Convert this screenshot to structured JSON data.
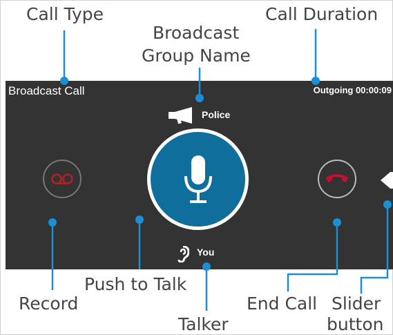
{
  "annotations": {
    "call_type": "Call Type",
    "call_duration": "Call Duration",
    "group_name_line1": "Broadcast",
    "group_name_line2": "Group Name",
    "record": "Record",
    "push_to_talk": "Push to Talk",
    "talker": "Talker",
    "end_call": "End Call",
    "slider_line1": "Slider",
    "slider_line2": "button"
  },
  "call_panel": {
    "call_type_label": "Broadcast Call",
    "status": "Outgoing 00:00:09",
    "group_name": "Police",
    "talker_name": "You",
    "icons": {
      "group": "megaphone-icon",
      "record": "voicemail-icon",
      "push_to_talk": "microphone-icon",
      "end_call": "phone-hangup-icon",
      "talker": "ear-icon",
      "slider": "slider-arrow-icon"
    }
  },
  "colors": {
    "accent_annotation": "#1a8fd6",
    "panel_background": "#333333",
    "ptt_button": "#0f6e9b",
    "record_red": "#b3202a",
    "end_call_red": "#c8102e"
  }
}
